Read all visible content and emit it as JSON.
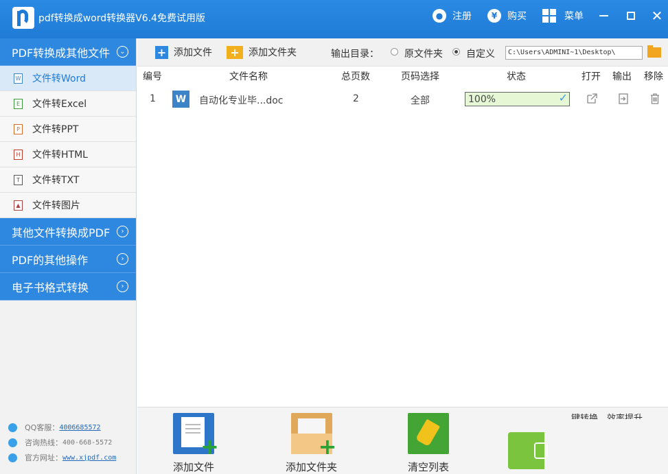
{
  "titlebar": {
    "title": "pdf转换成word转换器V6.4免费试用版",
    "register": "注册",
    "buy": "购买",
    "menu": "菜单"
  },
  "sidebar": {
    "header": "PDF转换成其他文件",
    "items": [
      {
        "label": "文件转Word",
        "icon": "W"
      },
      {
        "label": "文件转Excel",
        "icon": "E"
      },
      {
        "label": "文件转PPT",
        "icon": "P"
      },
      {
        "label": "文件转HTML",
        "icon": "H"
      },
      {
        "label": "文件转TXT",
        "icon": "T"
      },
      {
        "label": "文件转图片",
        "icon": "▲"
      }
    ],
    "sections": [
      "其他文件转换成PDF",
      "PDF的其他操作",
      "电子书格式转换"
    ],
    "footer": {
      "qq_label": "QQ客服：",
      "qq_value": "4006685572",
      "phone_label": "咨询热线：",
      "phone_value": "400-668-5572",
      "site_label": "官方网址：",
      "site_value": "www.xjpdf.com"
    }
  },
  "toolbar": {
    "add_file": "添加文件",
    "add_folder": "添加文件夹",
    "output_label": "输出目录：",
    "opt_original": "原文件夹",
    "opt_custom": "自定义",
    "output_path": "C:\\Users\\ADMINI~1\\Desktop\\"
  },
  "table": {
    "headers": {
      "num": "编号",
      "name": "文件名称",
      "pages": "总页数",
      "range": "页码选择",
      "status": "状态",
      "open": "打开",
      "output": "输出",
      "remove": "移除"
    },
    "rows": [
      {
        "num": "1",
        "icon": "W",
        "name": "自动化专业毕...doc",
        "pages": "2",
        "range": "全部",
        "status": "100%",
        "progress": 1.0
      }
    ]
  },
  "bottom": {
    "add_file": "添加文件",
    "add_folder": "添加文件夹",
    "clear_list": "清空列表",
    "tip": "键转换，效率提升"
  },
  "colors": {
    "accent": "#1f7bd6",
    "progress_bg": "#e5f7d4",
    "start_green": "#7ac43e"
  }
}
